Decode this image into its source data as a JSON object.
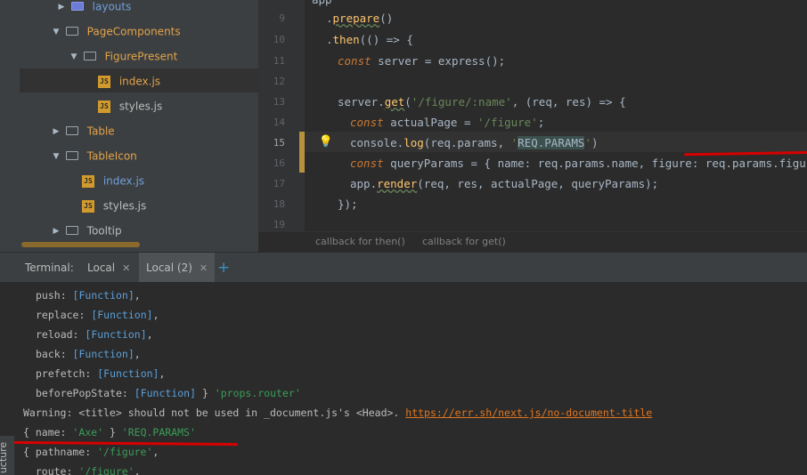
{
  "project_tree": {
    "items": [
      {
        "label": "layouts",
        "kind": "package",
        "arrow": "▶"
      },
      {
        "label": "PageComponents",
        "kind": "folder",
        "arrow": "▼"
      },
      {
        "label": "FigurePresent",
        "kind": "folder",
        "arrow": "▼"
      },
      {
        "label": "index.js",
        "kind": "js"
      },
      {
        "label": "styles.js",
        "kind": "js"
      },
      {
        "label": "Table",
        "kind": "folder",
        "arrow": "▶"
      },
      {
        "label": "TableIcon",
        "kind": "folder",
        "arrow": "▼"
      },
      {
        "label": "index.js",
        "kind": "js"
      },
      {
        "label": "styles.js",
        "kind": "js"
      },
      {
        "label": "Tooltip",
        "kind": "folder",
        "arrow": "▶"
      }
    ]
  },
  "editor": {
    "line_numbers": [
      "9",
      "10",
      "11",
      "12",
      "13",
      "14",
      "15",
      "16",
      "17",
      "18",
      "19"
    ],
    "lines": {
      "l8": "app",
      "l9_fn": "prepare",
      "l10_fn": "then",
      "l11_kw": "const",
      "l11_rest": " server = express();",
      "l13_a": "server.",
      "l13_fn": "get",
      "l13_str": "'/figure/:name'",
      "l13_rest": ", (req, res) => {",
      "l14_kw": "const",
      "l14_a": " actualPage = ",
      "l14_str": "'/figure'",
      "l15_a": "console.",
      "l15_fn": "log",
      "l15_b": "(req.params, ",
      "l15_q1": "'",
      "l15_str": "REQ.PARAMS",
      "l15_q2": "'",
      "l15_c": ")",
      "l16_kw": "const",
      "l16_rest": " queryParams = { name: req.params.name, figure: req.params.figure };",
      "l17_a": "app.",
      "l17_fn": "render",
      "l17_rest": "(req, res, actualPage, queryParams);",
      "l18": "});"
    },
    "breadcrumb": [
      "callback for then()",
      "callback for get()"
    ]
  },
  "terminal": {
    "label": "Terminal:",
    "tabs": [
      "Local",
      "Local (2)"
    ],
    "close_glyph": "✕",
    "add_glyph": "+",
    "structure_label": "ucture",
    "output": {
      "push": "push: ",
      "replace": "replace: ",
      "reload": "reload: ",
      "back": "back: ",
      "prefetch": "prefetch: ",
      "beforePopState": "beforePopState: ",
      "fn": "[Function]",
      "comma": ",",
      "router_tail": " } ",
      "router_str": "'props.router'",
      "warning_text": "Warning: <title> should not be used in _document.js's <Head>. ",
      "warning_link": "https://err.sh/next.js/no-document-title",
      "name_open": "{ name: ",
      "name_val": "'Axe'",
      "name_close": " } ",
      "name_str": "'REQ.PARAMS'",
      "pathname_key": "{ pathname: ",
      "pathname_val": "'/figure'",
      "route_key": "  route: ",
      "route_val": "'/figure'"
    }
  },
  "colors": {
    "keyword": "#cc7832",
    "function": "#ffc66d",
    "string": "#6a8759",
    "annotation_underline": "#d80000",
    "terminal_string": "#3b9c58",
    "link": "#e1761e"
  }
}
